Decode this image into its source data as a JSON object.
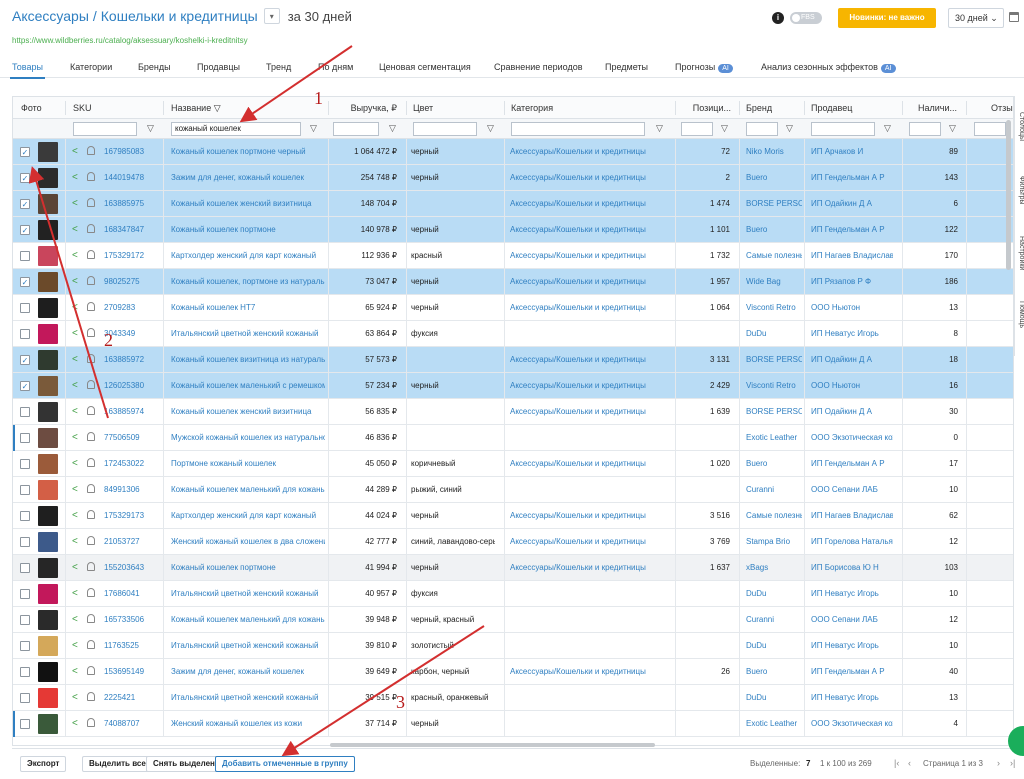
{
  "header": {
    "crumb1": "Аксессуары",
    "crumb2": "Кошельки и кредитницы",
    "period_text": "за 30 дней",
    "url": "https://www.wildberries.ru/catalog/aksessuary/koshelki-i-kreditnitsy",
    "fbs_label": "FBS",
    "novinki_label": "Новинки: не важно",
    "period_select": "30 дней"
  },
  "tabs": [
    "Товары",
    "Категории",
    "Бренды",
    "Продавцы",
    "Тренд",
    "По дням",
    "Ценовая сегментация",
    "Сравнение периодов",
    "Предметы",
    "Прогнозы",
    "Анализ сезонных эффектов"
  ],
  "ai_badge": "AI",
  "columns": {
    "photo": "Фото",
    "sku": "SKU",
    "name": "Название",
    "revenue": "Выручка, ₽",
    "color": "Цвет",
    "category": "Категория",
    "position": "Позици...",
    "brand": "Бренд",
    "seller": "Продавец",
    "stock": "Наличи...",
    "reviews": "Отзы"
  },
  "filter": {
    "name_value": "кожаный кошелек"
  },
  "rows": [
    {
      "sku": "167985083",
      "name": "Кожаный кошелек портмоне черный",
      "revenue": "1 064 472 ₽",
      "color": "черный",
      "category": "Аксессуары/Кошельки и кредитницы",
      "position": "72",
      "brand": "Niko Moris",
      "seller": "ИП Арчаков И",
      "stock": "89",
      "checked": true
    },
    {
      "sku": "144019478",
      "name": "Зажим для денег, кожаный кошелек",
      "revenue": "254 748 ₽",
      "color": "черный",
      "category": "Аксессуары/Кошельки и кредитницы",
      "position": "2",
      "brand": "Buero",
      "seller": "ИП Гендельман А Р",
      "stock": "143",
      "checked": true
    },
    {
      "sku": "163885975",
      "name": "Кожаный кошелек женский визитница",
      "revenue": "148 704 ₽",
      "color": "",
      "category": "Аксессуары/Кошельки и кредитницы",
      "position": "1 474",
      "brand": "BORSE PERSONALI",
      "seller": "ИП Одайкин Д А",
      "stock": "6",
      "checked": true
    },
    {
      "sku": "168347847",
      "name": "Кожаный кошелек портмоне",
      "revenue": "140 978 ₽",
      "color": "черный",
      "category": "Аксессуары/Кошельки и кредитницы",
      "position": "1 101",
      "brand": "Buero",
      "seller": "ИП Гендельман А Р",
      "stock": "122",
      "checked": true
    },
    {
      "sku": "175329172",
      "name": "Картхолдер женский для карт кожаный",
      "revenue": "112 936 ₽",
      "color": "красный",
      "category": "Аксессуары/Кошельки и кредитницы",
      "position": "1 732",
      "brand": "Самые полезные",
      "seller": "ИП Нагаев Владислав",
      "stock": "170",
      "checked": false
    },
    {
      "sku": "98025275",
      "name": "Кожаный кошелек, портмоне из натуральной",
      "revenue": "73 047 ₽",
      "color": "черный",
      "category": "Аксессуары/Кошельки и кредитницы",
      "position": "1 957",
      "brand": "Wide Bag",
      "seller": "ИП Рязапов Р Ф",
      "stock": "186",
      "checked": true
    },
    {
      "sku": "2709283",
      "name": "Кожаный кошелек HT7",
      "revenue": "65 924 ₽",
      "color": "черный",
      "category": "Аксессуары/Кошельки и кредитницы",
      "position": "1 064",
      "brand": "Visconti Retro",
      "seller": "ООО Ньютон",
      "stock": "13",
      "checked": false
    },
    {
      "sku": "3043349",
      "name": "Итальянский цветной женский кожаный",
      "revenue": "63 864 ₽",
      "color": "фуксия",
      "category": "",
      "position": "",
      "brand": "DuDu",
      "seller": "ИП Неватус Игорь",
      "stock": "8",
      "checked": false
    },
    {
      "sku": "163885972",
      "name": "Кожаный кошелек визитница из натуральной",
      "revenue": "57 573 ₽",
      "color": "",
      "category": "Аксессуары/Кошельки и кредитницы",
      "position": "3 131",
      "brand": "BORSE PERSONALI",
      "seller": "ИП Одайкин Д А",
      "stock": "18",
      "checked": true
    },
    {
      "sku": "126025380",
      "name": "Кожаный кошелек маленький с ремешком",
      "revenue": "57 234 ₽",
      "color": "черный",
      "category": "Аксессуары/Кошельки и кредитницы",
      "position": "2 429",
      "brand": "Visconti Retro",
      "seller": "ООО Ньютон",
      "stock": "16",
      "checked": true
    },
    {
      "sku": "163885974",
      "name": "Кожаный кошелек женский визитница",
      "revenue": "56 835 ₽",
      "color": "",
      "category": "Аксессуары/Кошельки и кредитницы",
      "position": "1 639",
      "brand": "BORSE PERSONALI",
      "seller": "ИП Одайкин Д А",
      "stock": "30",
      "checked": false
    },
    {
      "sku": "77506509",
      "name": "Мужской кожаный кошелек из натуральной",
      "revenue": "46 836 ₽",
      "color": "",
      "category": "",
      "position": "",
      "brand": "Exotic Leather",
      "seller": "ООО Экзотическая кожа",
      "stock": "0",
      "checked": false
    },
    {
      "sku": "172453022",
      "name": "Портмоне кожаный кошелек",
      "revenue": "45 050 ₽",
      "color": "коричневый",
      "category": "Аксессуары/Кошельки и кредитницы",
      "position": "1 020",
      "brand": "Buero",
      "seller": "ИП Гендельман А Р",
      "stock": "17",
      "checked": false
    },
    {
      "sku": "84991306",
      "name": "Кожаный кошелек маленький для кожаных",
      "revenue": "44 289 ₽",
      "color": "рыжий, синий",
      "category": "",
      "position": "",
      "brand": "Curanni",
      "seller": "ООО Сепани ЛАБ",
      "stock": "10",
      "checked": false
    },
    {
      "sku": "175329173",
      "name": "Картхолдер женский для карт кожаный",
      "revenue": "44 024 ₽",
      "color": "черный",
      "category": "Аксессуары/Кошельки и кредитницы",
      "position": "3 516",
      "brand": "Самые полезные",
      "seller": "ИП Нагаев Владислав",
      "stock": "62",
      "checked": false
    },
    {
      "sku": "21053727",
      "name": "Женский кожаный кошелек в два сложения",
      "revenue": "42 777 ₽",
      "color": "синий, лавандово-серый",
      "category": "Аксессуары/Кошельки и кредитницы",
      "position": "3 769",
      "brand": "Stampa Brio",
      "seller": "ИП Горелова Наталья",
      "stock": "12",
      "checked": false
    },
    {
      "sku": "155203643",
      "name": "Кожаный кошелек портмоне",
      "revenue": "41 994 ₽",
      "color": "черный",
      "category": "Аксессуары/Кошельки и кредитницы",
      "position": "1 637",
      "brand": "xBags",
      "seller": "ИП Борисова Ю Н",
      "stock": "103",
      "checked": false
    },
    {
      "sku": "17686041",
      "name": "Итальянский цветной женский кожаный",
      "revenue": "40 957 ₽",
      "color": "фуксия",
      "category": "",
      "position": "",
      "brand": "DuDu",
      "seller": "ИП Неватус Игорь",
      "stock": "10",
      "checked": false
    },
    {
      "sku": "165733506",
      "name": "Кожаный кошелек маленький для кожаных",
      "revenue": "39 948 ₽",
      "color": "черный, красный",
      "category": "",
      "position": "",
      "brand": "Curanni",
      "seller": "ООО Сепани ЛАБ",
      "stock": "12",
      "checked": false
    },
    {
      "sku": "11763525",
      "name": "Итальянский цветной женский кожаный",
      "revenue": "39 810 ₽",
      "color": "золотистый",
      "category": "",
      "position": "",
      "brand": "DuDu",
      "seller": "ИП Неватус Игорь",
      "stock": "10",
      "checked": false
    },
    {
      "sku": "153695149",
      "name": "Зажим для денег, кожаный кошелек",
      "revenue": "39 649 ₽",
      "color": "карбон, черный",
      "category": "Аксессуары/Кошельки и кредитницы",
      "position": "26",
      "brand": "Buero",
      "seller": "ИП Гендельман А Р",
      "stock": "40",
      "checked": false
    },
    {
      "sku": "2225421",
      "name": "Итальянский цветной женский кожаный",
      "revenue": "39 515 ₽",
      "color": "красный, оранжевый",
      "category": "",
      "position": "",
      "brand": "DuDu",
      "seller": "ИП Неватус Игорь",
      "stock": "13",
      "checked": false
    },
    {
      "sku": "74088707",
      "name": "Женский кожаный кошелек из кожи",
      "revenue": "37 714 ₽",
      "color": "черный",
      "category": "",
      "position": "",
      "brand": "Exotic Leather",
      "seller": "ООО Экзотическая кожа",
      "stock": "4",
      "checked": false
    }
  ],
  "side_panel": [
    "Столбцы",
    "Фильтры",
    "Настройки",
    "Помощь"
  ],
  "footer": {
    "export": "Экспорт",
    "select_all": "Выделить все",
    "deselect": "Снять выделение",
    "add_group": "Добавить отмеченные в группу",
    "selected_label": "Выделенные:",
    "selected_count": "7",
    "range": "1 к 100 из 269",
    "page": "Страница 1 из 3"
  },
  "annotations": [
    "1",
    "2",
    "3"
  ]
}
